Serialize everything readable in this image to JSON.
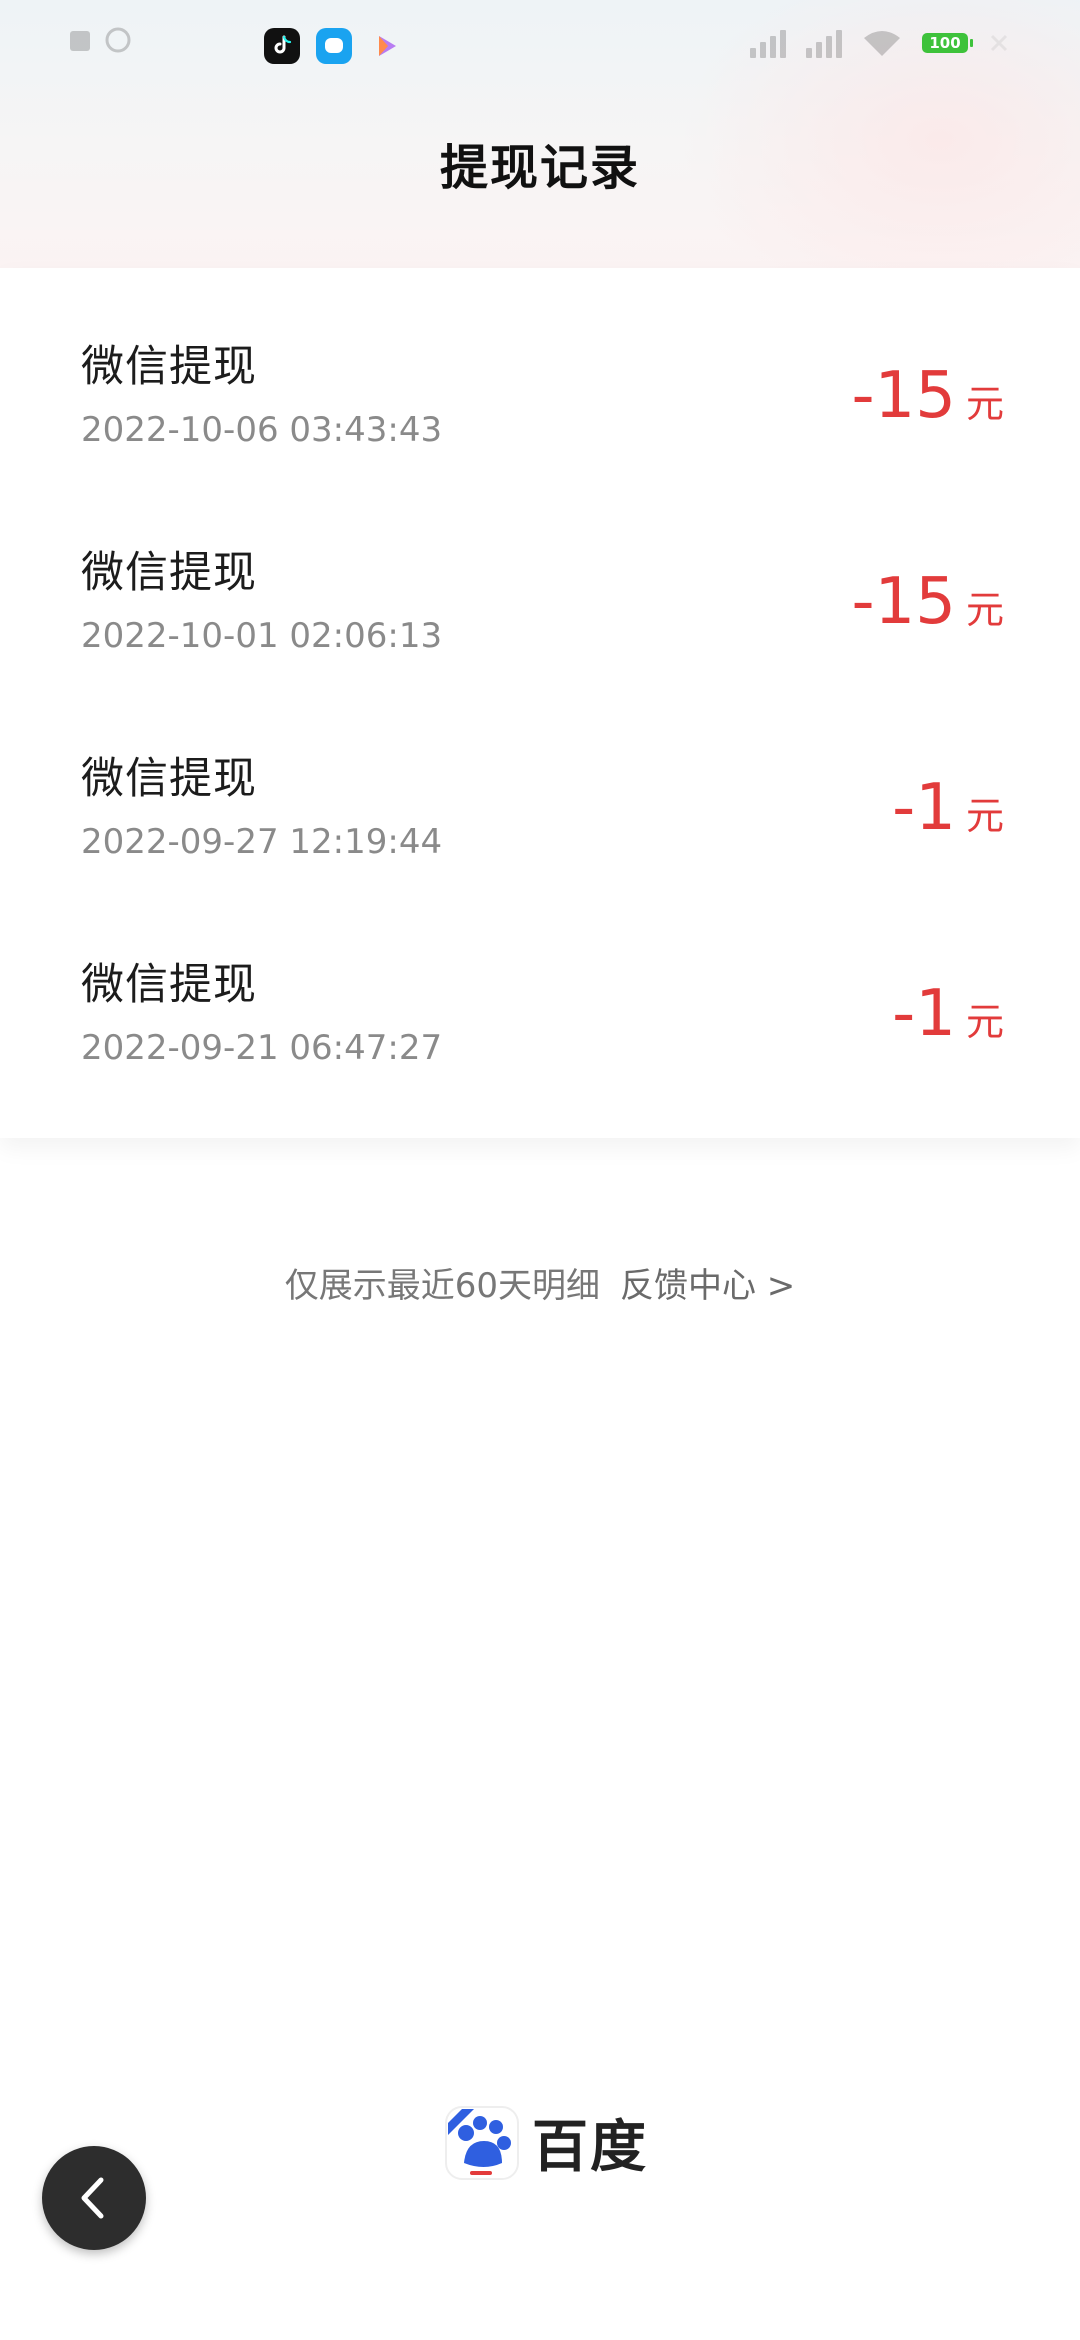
{
  "page": {
    "title": "提现记录"
  },
  "records": [
    {
      "title": "微信提现",
      "time": "2022-10-06 03:43:43",
      "amount": "-15",
      "unit": "元"
    },
    {
      "title": "微信提现",
      "time": "2022-10-01 02:06:13",
      "amount": "-15",
      "unit": "元"
    },
    {
      "title": "微信提现",
      "time": "2022-09-27 12:19:44",
      "amount": "-1",
      "unit": "元"
    },
    {
      "title": "微信提现",
      "time": "2022-09-21 06:47:27",
      "amount": "-1",
      "unit": "元"
    }
  ],
  "footer": {
    "note": "仅展示最近60天明细",
    "feedback_link": "反馈中心 >"
  },
  "brand": {
    "name": "百度"
  },
  "status_bar": {
    "battery": "100"
  },
  "colors": {
    "amount": "#e23b3b",
    "battery": "#3ec23b"
  },
  "icons": {
    "back": "chevron-left-icon"
  }
}
